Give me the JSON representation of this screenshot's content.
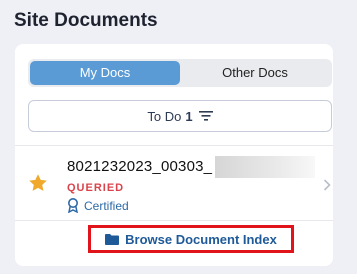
{
  "page": {
    "title": "Site Documents"
  },
  "tabs": [
    {
      "label": "My Docs",
      "active": true
    },
    {
      "label": "Other Docs",
      "active": false
    }
  ],
  "todo": {
    "label": "To Do",
    "count": "1",
    "icon": "filter-lines-icon"
  },
  "document": {
    "name": "8021232023_00303_",
    "status": "QUERIED",
    "certification": "Certified",
    "favorite_icon": "star-icon",
    "certified_icon": "certificate-ribbon-icon",
    "open_icon": "chevron-right-icon"
  },
  "footer": {
    "browse_label": "Browse Document Index",
    "browse_icon": "folder-icon"
  },
  "colors": {
    "accent": "#5b9bd5",
    "status_queried": "#d9434b",
    "link": "#1f5a98",
    "highlight_box": "#e2141b",
    "star": "#f0a92a"
  }
}
